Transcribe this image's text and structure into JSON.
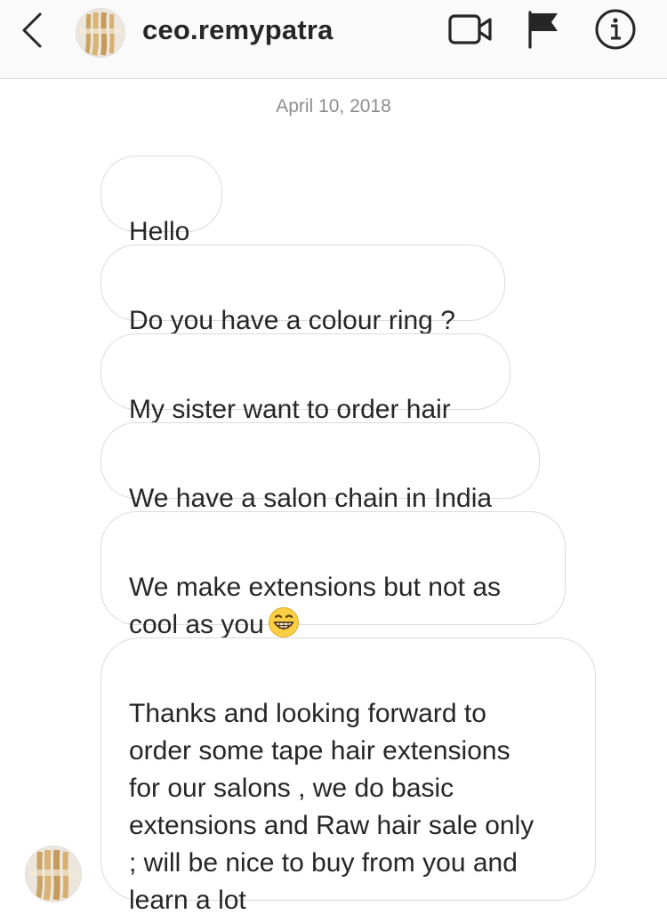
{
  "header": {
    "username": "ceo.remypatra",
    "icons": {
      "back": "chevron-left-icon",
      "video": "video-camera-icon",
      "flag": "flag-icon",
      "info": "info-icon"
    }
  },
  "conversation": {
    "date": "April 10, 2018",
    "messages": [
      {
        "text": "Hello"
      },
      {
        "text": "Do you have a colour ring ?"
      },
      {
        "text": "My sister want to order hair"
      },
      {
        "text": "We have a salon chain in India"
      },
      {
        "text": "We make extensions but not as\ncool as you",
        "emoji": "grinning-face-icon"
      },
      {
        "text": "Thanks and looking forward to\norder some tape hair extensions\nfor our salons , we do basic\nextensions and Raw hair sale only\n; will be nice to buy from you and\nlearn a lot"
      }
    ]
  },
  "colors": {
    "header_bg": "#fafafa",
    "bubble_border": "#dbdbdb",
    "text": "#262626",
    "muted": "#8e8e8e",
    "emoji_yellow": "#fbcf44"
  }
}
